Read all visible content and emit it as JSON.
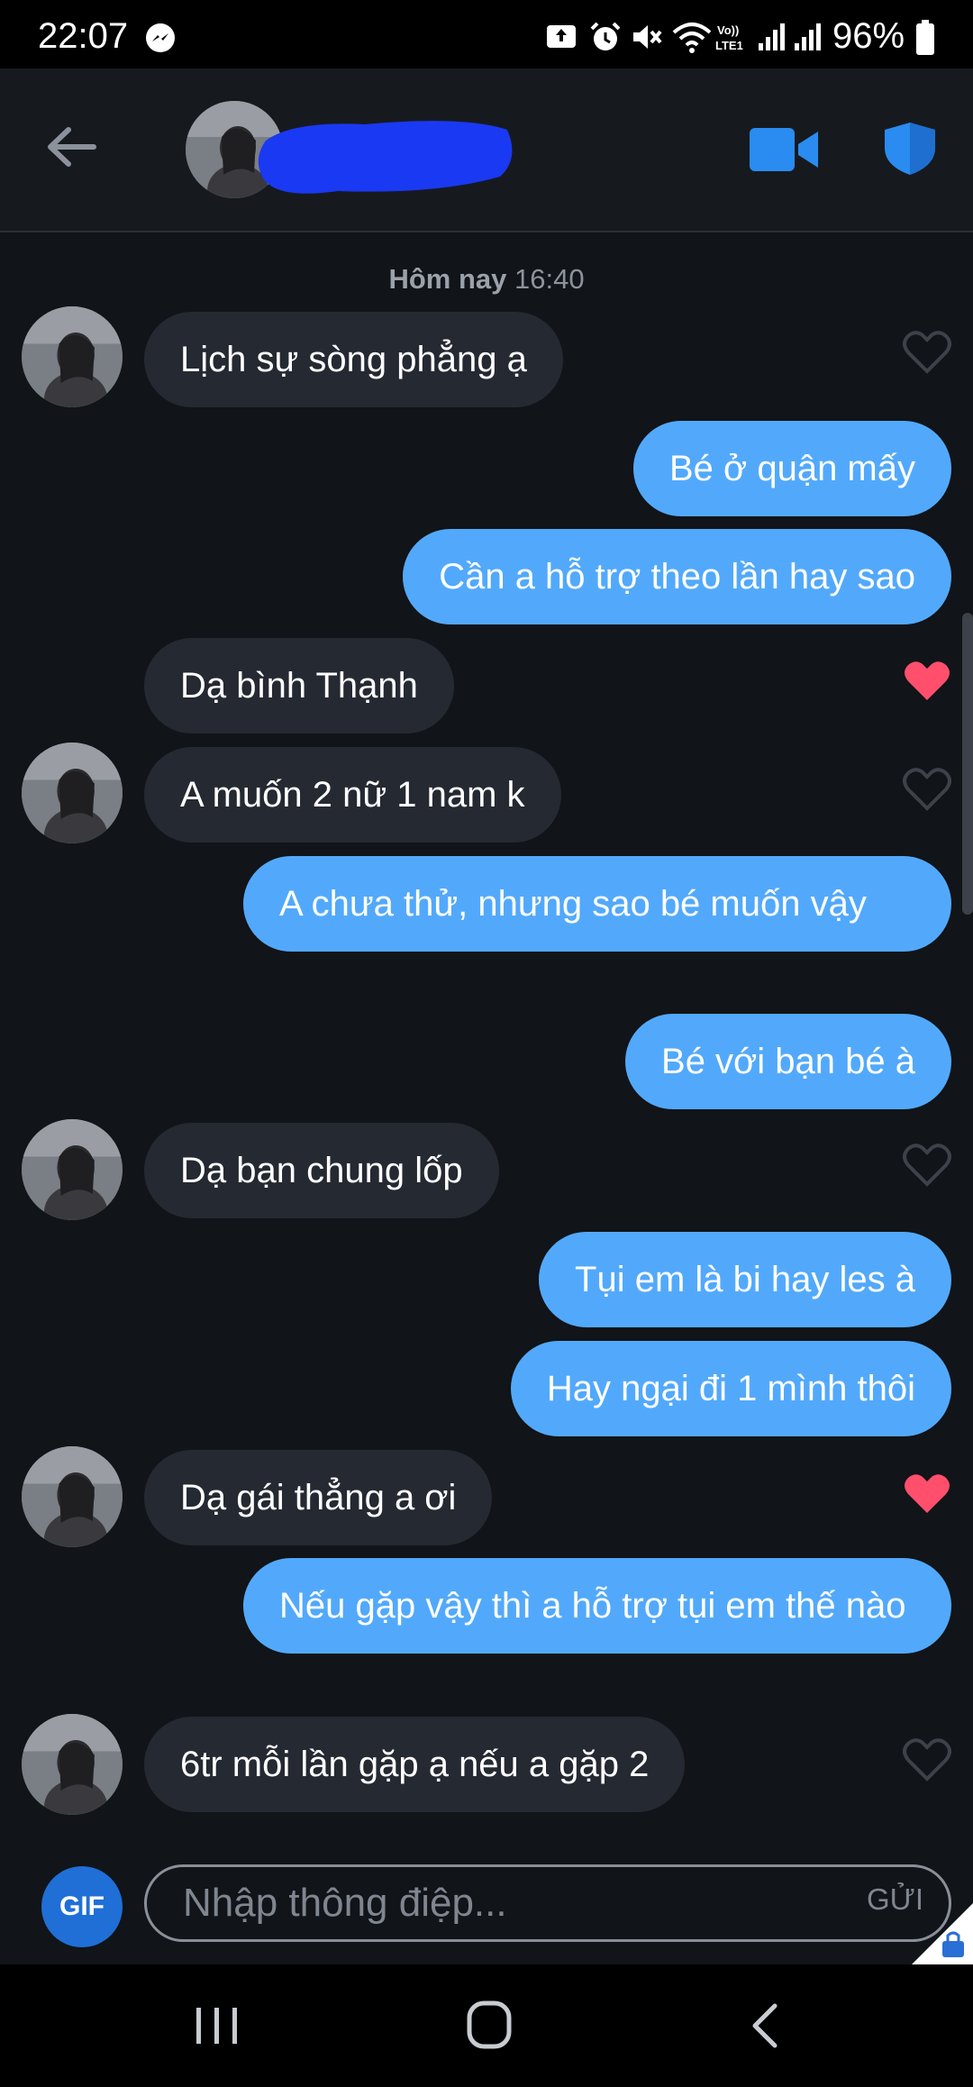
{
  "status_bar": {
    "time": "22:07",
    "battery": "96%",
    "icons": [
      "messenger-icon",
      "upload-icon",
      "alarm-icon",
      "mute-icon",
      "wifi-icon",
      "volte-icon",
      "signal-icon",
      "signal-icon",
      "battery-icon"
    ]
  },
  "header": {
    "back_icon": "arrow-left-icon",
    "video_icon": "video-camera-icon",
    "shield_icon": "shield-icon",
    "accent_color": "#2a8cf0"
  },
  "timestamp": {
    "day": "Hôm nay",
    "time": "16:40"
  },
  "messages": [
    {
      "side": "in",
      "text": "Lịch sự sòng phẳng ạ",
      "avatar": true,
      "liked": false
    },
    {
      "side": "out",
      "text": "Bé ở quận mấy"
    },
    {
      "side": "out",
      "text": "Cần a hỗ trợ theo lần hay sao"
    },
    {
      "side": "in",
      "text": "Dạ bình Thạnh",
      "avatar": false,
      "liked": true
    },
    {
      "side": "in",
      "text": "A muốn 2 nữ 1 nam k",
      "avatar": true,
      "liked": false
    },
    {
      "side": "out",
      "text": "A chưa thử, nhưng sao bé muốn vậy"
    },
    {
      "side": "out",
      "text": "Bé với bạn bé à"
    },
    {
      "side": "in",
      "text": "Dạ bạn chung lốp",
      "avatar": true,
      "liked": false
    },
    {
      "side": "out",
      "text": "Tụi em là bi hay les à"
    },
    {
      "side": "out",
      "text": "Hay ngại đi 1 mình thôi"
    },
    {
      "side": "in",
      "text": "Dạ gái thẳng a ơi",
      "avatar": true,
      "liked": true
    },
    {
      "side": "out",
      "text": "Nếu gặp vậy thì a hỗ trợ tụi em thế nào"
    },
    {
      "side": "in",
      "text": "6tr mỗi lần gặp ạ nếu a gặp 2",
      "avatar": true,
      "liked": false
    }
  ],
  "composer": {
    "gif_label": "GIF",
    "placeholder": "Nhập thông điệp...",
    "send_label": "GỬI"
  },
  "colors": {
    "background": "#111418",
    "incoming_bubble": "#252932",
    "outgoing_bubble": "#52a9fb",
    "heart_liked": "#ff4f6d",
    "heart_empty": "#3d424a"
  },
  "nav_bar": {
    "icons": [
      "recent-apps-icon",
      "home-icon",
      "back-icon"
    ]
  }
}
